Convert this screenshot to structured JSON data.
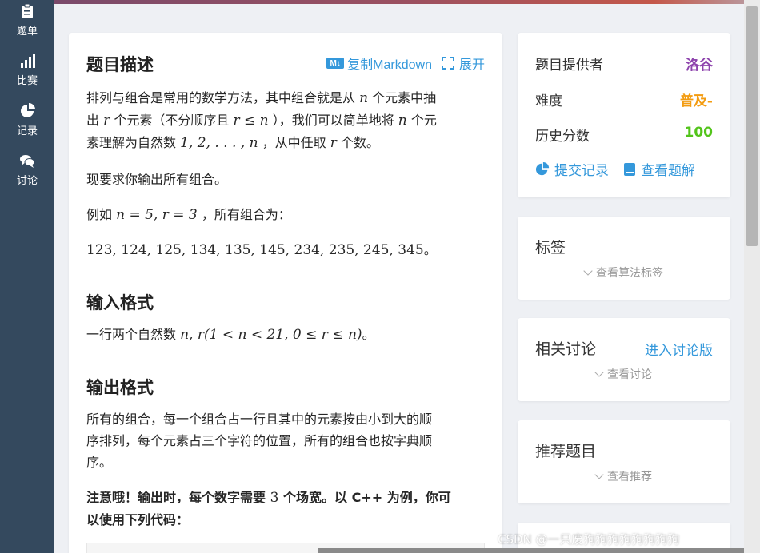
{
  "nav": {
    "items": [
      {
        "label": "题单",
        "icon": "clipboard-icon"
      },
      {
        "label": "比赛",
        "icon": "bar-signal-icon"
      },
      {
        "label": "记录",
        "icon": "pie-chart-icon"
      },
      {
        "label": "讨论",
        "icon": "chat-bubbles-icon"
      }
    ]
  },
  "problem": {
    "title": "题目描述",
    "copy_markdown": "复制Markdown",
    "md_badge": "M↓",
    "expand": "展开",
    "desc_line1_a": "排列与组合是常用的数学方法，其中组合就是从",
    "desc_line1_n": "n",
    "desc_line1_b": "个元素中抽",
    "desc_line2_a": "出",
    "desc_line2_r": "r",
    "desc_line2_b": "个元素（不分顺序且",
    "desc_line2_math": "r ≤ n",
    "desc_line2_c": "），我们可以简单地将",
    "desc_line2_n": "n",
    "desc_line2_d": "个元",
    "desc_line3_a": "素理解为自然数",
    "desc_line3_math": "1, 2, . . . , n",
    "desc_line3_b": "，从中任取",
    "desc_line3_r": "r",
    "desc_line3_c": "个数。",
    "req": "现要求你输出所有组合。",
    "example_a": "例如",
    "example_math": "n = 5, r = 3",
    "example_b": "，所有组合为：",
    "combos": "123, 124, 125, 134, 135, 145, 234, 235, 245, 345",
    "combos_end": "。",
    "input_title": "输入格式",
    "input_a": "一行两个自然数",
    "input_math": "n, r(1 < n < 21, 0 ≤ r ≤ n)",
    "input_b": "。",
    "output_title": "输出格式",
    "output_line1": "所有的组合，每一个组合占一行且其中的元素按由小到大的顺",
    "output_line2": "序排列，每个元素占三个字符的位置，所有的组合也按字典顺",
    "output_line3": "序。",
    "note_a": "注意哦！输出时，每个数字需要",
    "note_math": "3",
    "note_b": "个场宽。以 C++ 为例，你可",
    "note_line2": "以使用下列代码："
  },
  "info": {
    "provider_label": "题目提供者",
    "provider_value": "洛谷",
    "difficulty_label": "难度",
    "difficulty_value": "普及-",
    "score_label": "历史分数",
    "score_value": "100",
    "submissions": "提交记录",
    "solutions": "查看题解"
  },
  "tags": {
    "title": "标签",
    "more": "查看算法标签"
  },
  "discuss": {
    "title": "相关讨论",
    "link": "进入讨论版",
    "more": "查看讨论"
  },
  "recommend": {
    "title": "推荐题目",
    "more": "查看推荐"
  },
  "watermark": "CSDN @一只废狗狗狗狗狗狗狗狗",
  "colors": {
    "sidebar": "#34495e",
    "link": "#3498db",
    "provider": "#8e44ad",
    "difficulty": "#f39c11",
    "score": "#52c41a"
  }
}
